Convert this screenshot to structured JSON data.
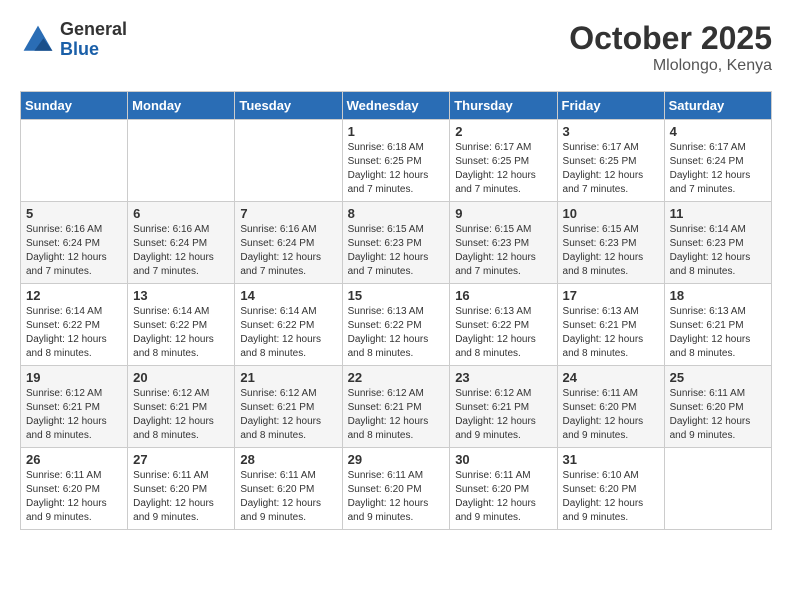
{
  "header": {
    "logo_line1": "General",
    "logo_line2": "Blue",
    "month": "October 2025",
    "location": "Mlolongo, Kenya"
  },
  "weekdays": [
    "Sunday",
    "Monday",
    "Tuesday",
    "Wednesday",
    "Thursday",
    "Friday",
    "Saturday"
  ],
  "weeks": [
    [
      {
        "day": "",
        "info": ""
      },
      {
        "day": "",
        "info": ""
      },
      {
        "day": "",
        "info": ""
      },
      {
        "day": "1",
        "info": "Sunrise: 6:18 AM\nSunset: 6:25 PM\nDaylight: 12 hours\nand 7 minutes."
      },
      {
        "day": "2",
        "info": "Sunrise: 6:17 AM\nSunset: 6:25 PM\nDaylight: 12 hours\nand 7 minutes."
      },
      {
        "day": "3",
        "info": "Sunrise: 6:17 AM\nSunset: 6:25 PM\nDaylight: 12 hours\nand 7 minutes."
      },
      {
        "day": "4",
        "info": "Sunrise: 6:17 AM\nSunset: 6:24 PM\nDaylight: 12 hours\nand 7 minutes."
      }
    ],
    [
      {
        "day": "5",
        "info": "Sunrise: 6:16 AM\nSunset: 6:24 PM\nDaylight: 12 hours\nand 7 minutes."
      },
      {
        "day": "6",
        "info": "Sunrise: 6:16 AM\nSunset: 6:24 PM\nDaylight: 12 hours\nand 7 minutes."
      },
      {
        "day": "7",
        "info": "Sunrise: 6:16 AM\nSunset: 6:24 PM\nDaylight: 12 hours\nand 7 minutes."
      },
      {
        "day": "8",
        "info": "Sunrise: 6:15 AM\nSunset: 6:23 PM\nDaylight: 12 hours\nand 7 minutes."
      },
      {
        "day": "9",
        "info": "Sunrise: 6:15 AM\nSunset: 6:23 PM\nDaylight: 12 hours\nand 7 minutes."
      },
      {
        "day": "10",
        "info": "Sunrise: 6:15 AM\nSunset: 6:23 PM\nDaylight: 12 hours\nand 8 minutes."
      },
      {
        "day": "11",
        "info": "Sunrise: 6:14 AM\nSunset: 6:23 PM\nDaylight: 12 hours\nand 8 minutes."
      }
    ],
    [
      {
        "day": "12",
        "info": "Sunrise: 6:14 AM\nSunset: 6:22 PM\nDaylight: 12 hours\nand 8 minutes."
      },
      {
        "day": "13",
        "info": "Sunrise: 6:14 AM\nSunset: 6:22 PM\nDaylight: 12 hours\nand 8 minutes."
      },
      {
        "day": "14",
        "info": "Sunrise: 6:14 AM\nSunset: 6:22 PM\nDaylight: 12 hours\nand 8 minutes."
      },
      {
        "day": "15",
        "info": "Sunrise: 6:13 AM\nSunset: 6:22 PM\nDaylight: 12 hours\nand 8 minutes."
      },
      {
        "day": "16",
        "info": "Sunrise: 6:13 AM\nSunset: 6:22 PM\nDaylight: 12 hours\nand 8 minutes."
      },
      {
        "day": "17",
        "info": "Sunrise: 6:13 AM\nSunset: 6:21 PM\nDaylight: 12 hours\nand 8 minutes."
      },
      {
        "day": "18",
        "info": "Sunrise: 6:13 AM\nSunset: 6:21 PM\nDaylight: 12 hours\nand 8 minutes."
      }
    ],
    [
      {
        "day": "19",
        "info": "Sunrise: 6:12 AM\nSunset: 6:21 PM\nDaylight: 12 hours\nand 8 minutes."
      },
      {
        "day": "20",
        "info": "Sunrise: 6:12 AM\nSunset: 6:21 PM\nDaylight: 12 hours\nand 8 minutes."
      },
      {
        "day": "21",
        "info": "Sunrise: 6:12 AM\nSunset: 6:21 PM\nDaylight: 12 hours\nand 8 minutes."
      },
      {
        "day": "22",
        "info": "Sunrise: 6:12 AM\nSunset: 6:21 PM\nDaylight: 12 hours\nand 8 minutes."
      },
      {
        "day": "23",
        "info": "Sunrise: 6:12 AM\nSunset: 6:21 PM\nDaylight: 12 hours\nand 9 minutes."
      },
      {
        "day": "24",
        "info": "Sunrise: 6:11 AM\nSunset: 6:20 PM\nDaylight: 12 hours\nand 9 minutes."
      },
      {
        "day": "25",
        "info": "Sunrise: 6:11 AM\nSunset: 6:20 PM\nDaylight: 12 hours\nand 9 minutes."
      }
    ],
    [
      {
        "day": "26",
        "info": "Sunrise: 6:11 AM\nSunset: 6:20 PM\nDaylight: 12 hours\nand 9 minutes."
      },
      {
        "day": "27",
        "info": "Sunrise: 6:11 AM\nSunset: 6:20 PM\nDaylight: 12 hours\nand 9 minutes."
      },
      {
        "day": "28",
        "info": "Sunrise: 6:11 AM\nSunset: 6:20 PM\nDaylight: 12 hours\nand 9 minutes."
      },
      {
        "day": "29",
        "info": "Sunrise: 6:11 AM\nSunset: 6:20 PM\nDaylight: 12 hours\nand 9 minutes."
      },
      {
        "day": "30",
        "info": "Sunrise: 6:11 AM\nSunset: 6:20 PM\nDaylight: 12 hours\nand 9 minutes."
      },
      {
        "day": "31",
        "info": "Sunrise: 6:10 AM\nSunset: 6:20 PM\nDaylight: 12 hours\nand 9 minutes."
      },
      {
        "day": "",
        "info": ""
      }
    ]
  ]
}
